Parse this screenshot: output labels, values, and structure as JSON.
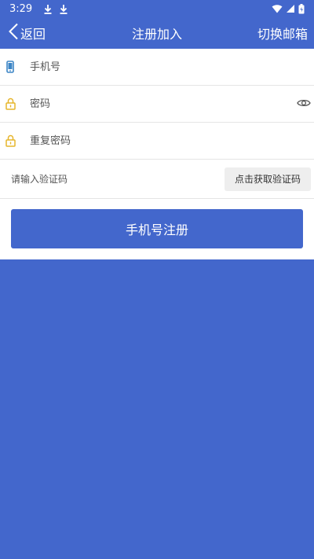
{
  "status_bar": {
    "time": "3:29",
    "left_icons": [
      "download-icon",
      "download-icon"
    ],
    "right_icons": [
      "wifi-icon",
      "signal-icon",
      "battery-icon"
    ]
  },
  "app_bar": {
    "back_label": "返回",
    "title": "注册加入",
    "switch_label": "切换邮箱"
  },
  "form": {
    "phone": {
      "placeholder": "手机号",
      "value": ""
    },
    "password": {
      "placeholder": "密码",
      "value": ""
    },
    "confirm_password": {
      "placeholder": "重复密码",
      "value": ""
    },
    "verify_code": {
      "placeholder": "请输入验证码",
      "value": ""
    },
    "get_code_label": "点击获取验证码",
    "submit_label": "手机号注册"
  },
  "colors": {
    "brand_blue": "#4367cc",
    "phone_icon": "#3d86c6",
    "lock_icon": "#e6b52c",
    "eye_icon": "#555555"
  }
}
